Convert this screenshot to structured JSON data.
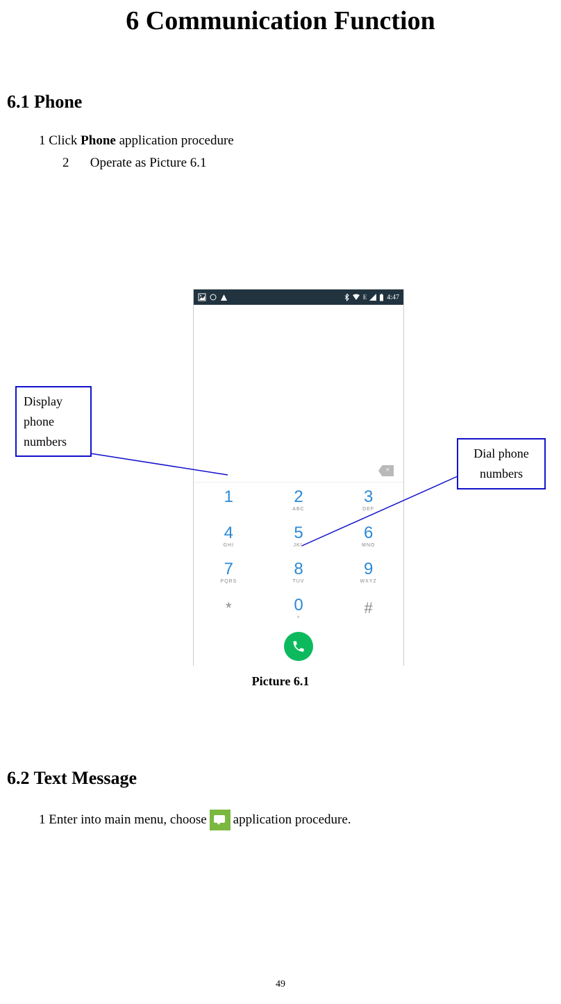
{
  "title": "6 Communication Function",
  "section61": {
    "heading": "6.1 Phone",
    "step1_prefix": "1 Click ",
    "step1_bold": "Phone",
    "step1_suffix": " application procedure",
    "step2_num": "2",
    "step2_text": "Operate as Picture 6.1"
  },
  "figure": {
    "caption": "Picture 6.1",
    "status_time": "4:47",
    "status_net": "E",
    "dialpad": {
      "k1": {
        "d": "1",
        "l": " "
      },
      "k2": {
        "d": "2",
        "l": "ABC"
      },
      "k3": {
        "d": "3",
        "l": "DEF"
      },
      "k4": {
        "d": "4",
        "l": "GHI"
      },
      "k5": {
        "d": "5",
        "l": "JKL"
      },
      "k6": {
        "d": "6",
        "l": "MNO"
      },
      "k7": {
        "d": "7",
        "l": "PQRS"
      },
      "k8": {
        "d": "8",
        "l": "TUV"
      },
      "k9": {
        "d": "9",
        "l": "WXYZ"
      },
      "kstar": "*",
      "k0": {
        "d": "0",
        "l": "+"
      },
      "khash": "#"
    }
  },
  "callouts": {
    "left": "Display phone numbers",
    "right": "Dial phone numbers"
  },
  "section62": {
    "heading": "6.2 Text Message",
    "step1_prefix": "1 Enter into main menu, choose",
    "step1_suffix": "application procedure."
  },
  "page_number": "49"
}
